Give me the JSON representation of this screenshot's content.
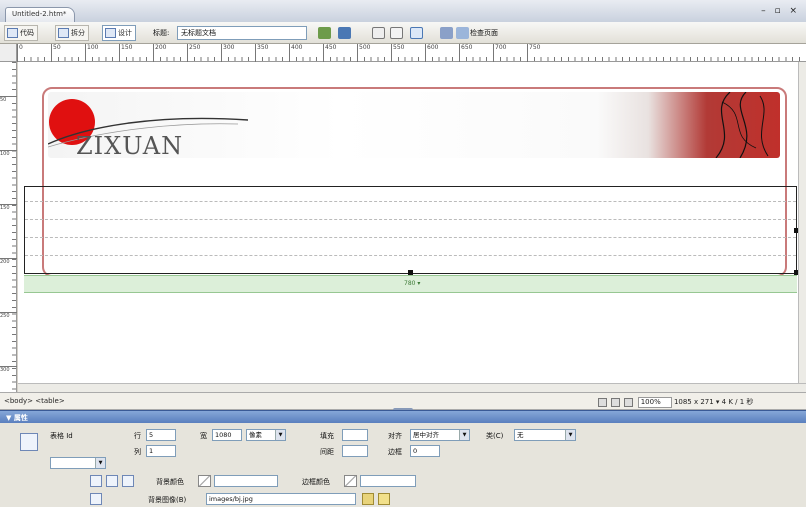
{
  "window": {
    "doc_tab": "Untitled-2.htm*",
    "controls": "– ▫ ×"
  },
  "toolbar": {
    "code_label": "代码",
    "split_label": "拆分",
    "design_label": "设计",
    "title_label": "标题:",
    "title_value": "无标题文档",
    "check_page_label": "检查页面"
  },
  "ruler": {
    "h_ticks": [
      "0",
      "50",
      "100",
      "150",
      "200",
      "250",
      "300",
      "350",
      "400",
      "450",
      "500",
      "550",
      "600",
      "650",
      "700",
      "750"
    ],
    "v_ticks": [
      "50",
      "100",
      "150",
      "200",
      "250",
      "300"
    ]
  },
  "canvas": {
    "logo_text": "ZIXUAN",
    "table_width_label": "780 ▾"
  },
  "statusbar": {
    "tag_path": "<body> <table>",
    "zoom": "100%",
    "size_info": "1085 x 271 ▾ 4 K / 1 秒"
  },
  "properties": {
    "panel_title": "▼ 属性",
    "element_label": "表格 Id",
    "rows_label": "行",
    "rows_value": "5",
    "cols_label": "列",
    "cols_value": "1",
    "width_label": "宽",
    "width_value": "1080",
    "width_unit": "像素",
    "padding_label": "填充",
    "padding_value": "",
    "spacing_label": "间距",
    "spacing_value": "",
    "align_label": "对齐",
    "align_value": "居中对齐",
    "border_label": "边框",
    "border_value": "0",
    "class_label": "类(C)",
    "class_value": "无",
    "bgcolor_label": "背景颜色",
    "bordercolor_label": "边框颜色",
    "bgimage_label": "背景图像(B)",
    "bgimage_value": "images/bj.jpg"
  },
  "colors": {
    "sun": "#e01010",
    "banner_red": "#c0302b",
    "frame": "#c97a7a",
    "width_bar": "#dcefd9",
    "panel_header": "#5a7fbe"
  }
}
